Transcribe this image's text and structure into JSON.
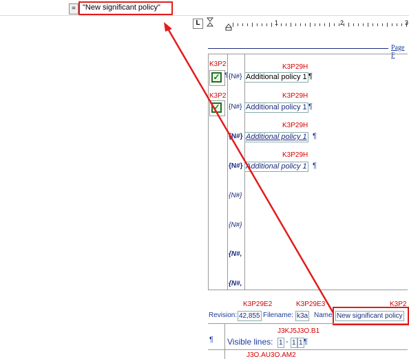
{
  "formula": {
    "eq_sign": "=",
    "value": "\"New significant policy\""
  },
  "toolbar": {
    "tab_stop_symbol": "L"
  },
  "ruler": {
    "numbers": [
      "1",
      "2",
      "3"
    ]
  },
  "page_link": "Page F",
  "rows": [
    {
      "tag": "K3P2",
      "label": "K3P29H",
      "nhash": "{N#}",
      "text": "Additional policy 1",
      "pilcrow": "¶",
      "checkbox": true
    },
    {
      "tag": "K3P2",
      "label": "K3P29H",
      "nhash": "{N#}",
      "text": "Additional policy 1",
      "pilcrow": "¶",
      "checkbox": true
    },
    {
      "label": "K3P29H",
      "nhash": "{N#}",
      "text": "Additional policy 1",
      "pilcrow": "¶"
    },
    {
      "label": "K3P29H",
      "nhash": "{N#}",
      "text": "Additional policy 1",
      "pilcrow": "¶"
    }
  ],
  "extra_nhash": [
    "{N#}",
    "{N#}",
    "{N#,",
    "{N#,"
  ],
  "pilcrow_small": "¶",
  "revision": {
    "label_revision": "Revision:",
    "value_revision": "42,855",
    "rev_tag": "K3P29E2",
    "label_filename": "Filename:",
    "value_filename": "k3a",
    "file_tag": "K3P29E3",
    "label_name": "Name",
    "value_name": "New significant policy",
    "name_tag": "K3P2"
  },
  "visible": {
    "tag": "J3KJ5J3O.B1",
    "label": "Visible lines:",
    "v1": "1",
    "dash": "-",
    "v2": "1",
    "v3": "1",
    "pilcrow": "¶",
    "left_pilcrow": "¶"
  },
  "bottom_tag": "J3O.AU3O.AM2"
}
